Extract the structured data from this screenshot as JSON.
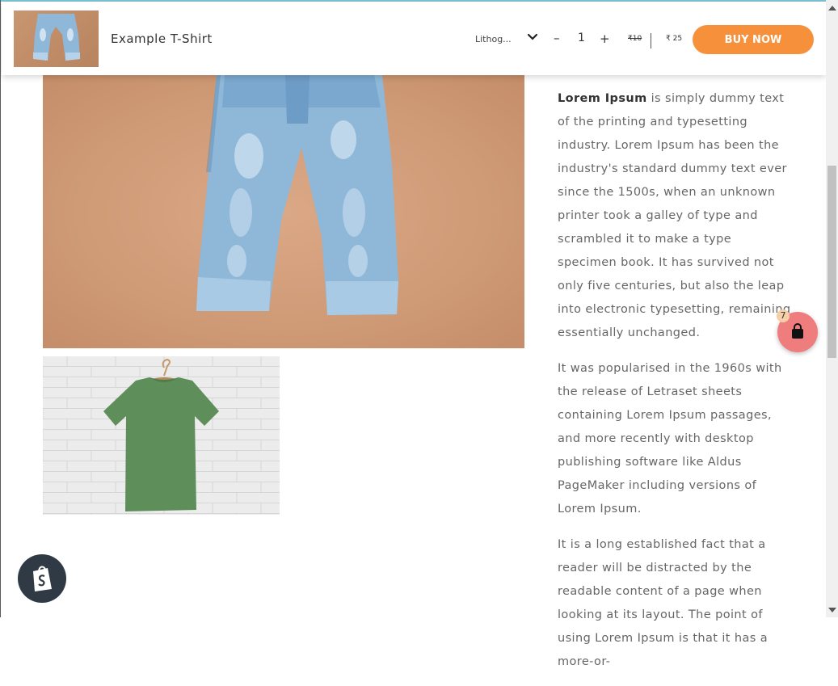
{
  "product_bar": {
    "title": "Example T-Shirt",
    "variant": "Lithog...",
    "quantity": "1",
    "minus": "–",
    "plus": "+",
    "compare_price": "₹10",
    "price": "₹ 25",
    "buy_label": "BUY NOW"
  },
  "description": {
    "p1_bold": "Lorem Ipsum",
    "p1_rest": " is simply dummy text of the printing and typesetting industry. Lorem Ipsum has been the industry's standard dummy text ever since the 1500s, when an unknown printer took a galley of type and scrambled it to make a type specimen book. It has survived not only five centuries, but also the leap into electronic typesetting, remaining essentially unchanged.",
    "p2": "It was popularised in the 1960s with the release of Letraset sheets containing Lorem Ipsum passages, and more recently with desktop publishing software like Aldus PageMaker including versions of Lorem Ipsum.",
    "p3": "It is a long established fact that a reader will be distracted by the readable content of a page when looking at its layout. The point of using Lorem Ipsum is that it has a more-or-"
  },
  "cart": {
    "count": "7",
    "icon": "shopping-bag-icon",
    "color": "#ef7d7d"
  },
  "icons": {
    "shopify": "shopify-logo-icon",
    "chevron": "chevron-down-icon"
  },
  "colors": {
    "buy_button": "#f7903a",
    "text": "#666666"
  }
}
